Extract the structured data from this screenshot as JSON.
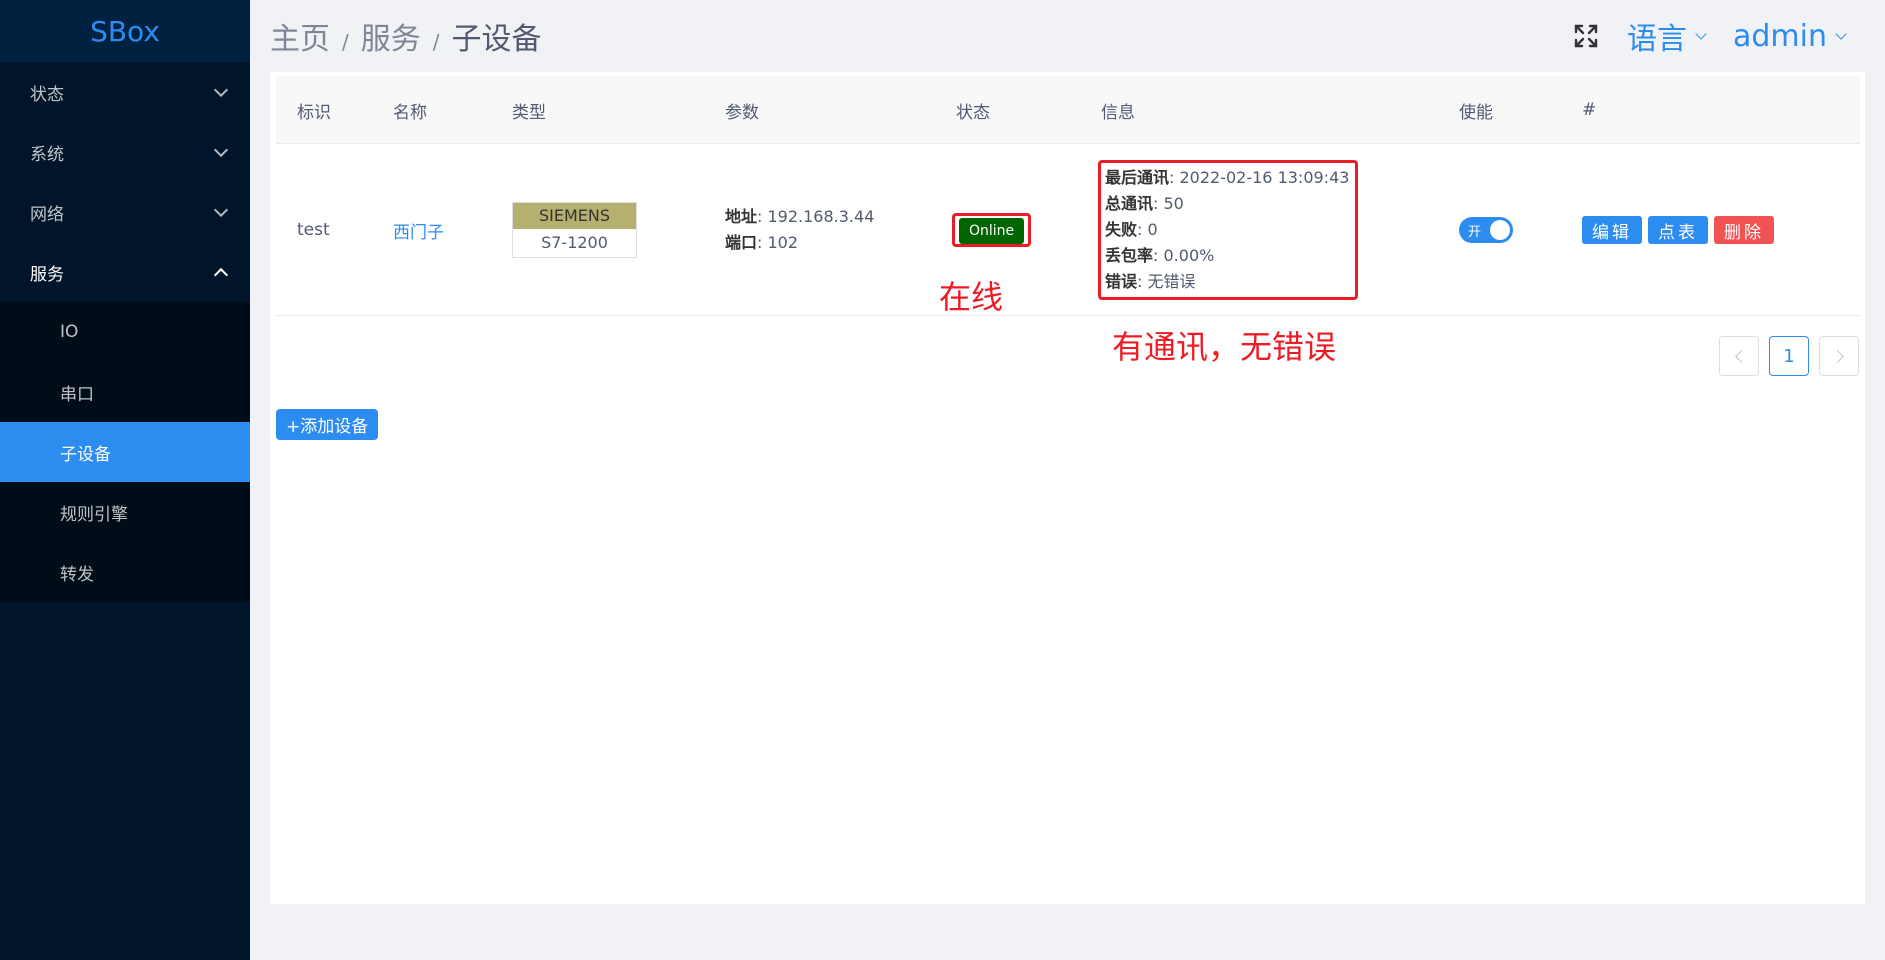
{
  "sidebar": {
    "logo": "SBox",
    "menus": [
      {
        "label": "状态"
      },
      {
        "label": "系统"
      },
      {
        "label": "网络"
      },
      {
        "label": "服务"
      }
    ],
    "submenu": [
      {
        "label": "IO"
      },
      {
        "label": "串口"
      },
      {
        "label": "子设备"
      },
      {
        "label": "规则引擎"
      },
      {
        "label": "转发"
      }
    ]
  },
  "header": {
    "breadcrumb": [
      "主页",
      "服务",
      "子设备"
    ],
    "separator": "/",
    "language": "语言",
    "user": "admin"
  },
  "table": {
    "columns": [
      "标识",
      "名称",
      "类型",
      "参数",
      "状态",
      "信息",
      "使能",
      "#"
    ],
    "rows": [
      {
        "id": "test",
        "name": "西门子",
        "type_vendor": "SIEMENS",
        "type_model": "S7-1200",
        "param_addr_label": "地址",
        "param_addr": ": 192.168.3.44",
        "param_port_label": "端口",
        "param_port": ": 102",
        "status": "Online",
        "info": [
          {
            "label": "最后通讯",
            "value": ": 2022-02-16 13:09:43"
          },
          {
            "label": "总通讯",
            "value": ": 50"
          },
          {
            "label": "失败",
            "value": ": 0"
          },
          {
            "label": "丢包率",
            "value": ": 0.00%"
          },
          {
            "label": "错误",
            "value": ": 无错误"
          }
        ],
        "enable_label": "开",
        "actions": [
          "编辑",
          "点表",
          "删除"
        ]
      }
    ]
  },
  "annotations": {
    "online": "在线",
    "info": "有通讯，无错误"
  },
  "pagination": {
    "current": "1"
  },
  "add_button": "+添加设备",
  "colors": {
    "sidebar_bg": "#001529",
    "accent": "#2d8cf0",
    "online": "#006400",
    "annotation": "#ed1c24",
    "danger": "#f15353",
    "type_header": "#b5b06f"
  }
}
